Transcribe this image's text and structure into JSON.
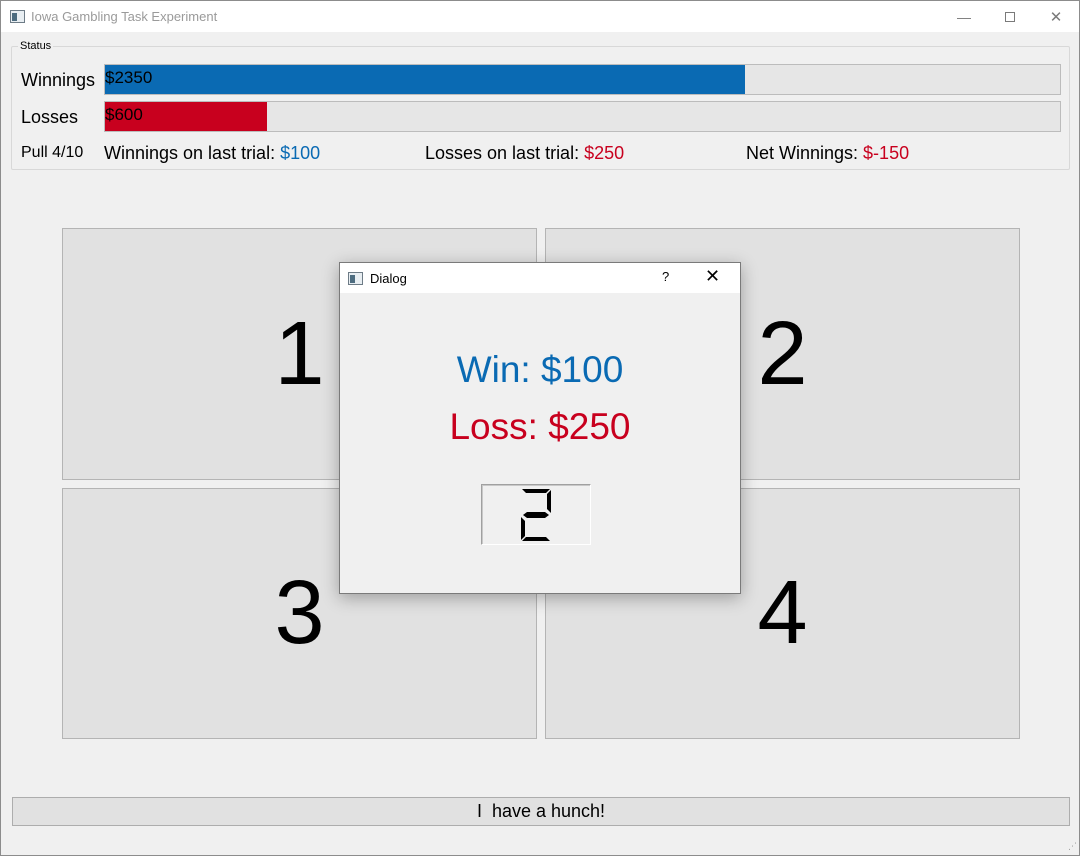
{
  "window": {
    "title": "Iowa Gambling Task Experiment",
    "controls": {
      "minimize": "—",
      "close": "✕"
    }
  },
  "status": {
    "legend": "Status",
    "winnings_label": "Winnings",
    "winnings_text": "$2350",
    "winnings_fraction": 0.67,
    "losses_label": "Losses",
    "losses_text": "$600",
    "losses_fraction": 0.17,
    "pull": "Pull 4/10",
    "last_win_label": "Winnings on last trial: ",
    "last_win_value": "$100",
    "last_loss_label": "Losses on last trial: ",
    "last_loss_value": "$250",
    "net_label": "Net Winnings: ",
    "net_value": "$-150",
    "colors": {
      "win": "#0a6ab3",
      "loss": "#c8001e"
    }
  },
  "decks": [
    {
      "label": "1"
    },
    {
      "label": "2"
    },
    {
      "label": "3"
    },
    {
      "label": "4"
    }
  ],
  "hunch_button": "I  have a hunch!",
  "dialog": {
    "title": "Dialog",
    "help": "?",
    "close": "✕",
    "win_text": "Win: $100",
    "loss_text": "Loss: $250",
    "lcd_value": 2
  }
}
